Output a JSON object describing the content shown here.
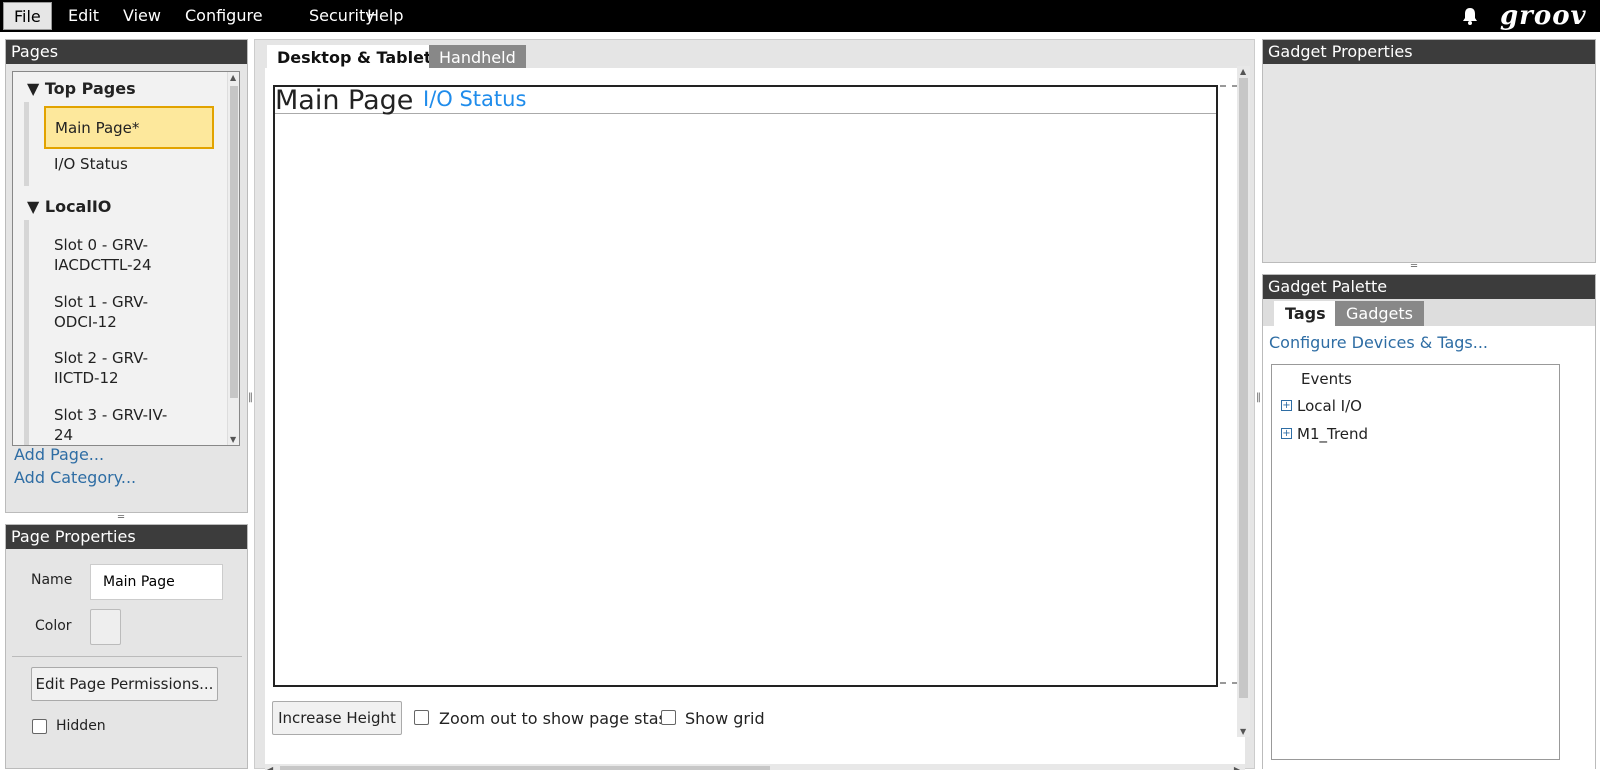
{
  "menu": [
    "File",
    "Edit",
    "View",
    "Configure",
    "Security",
    "Help"
  ],
  "brand": {
    "logo_text": "groov",
    "icon": "bell-icon"
  },
  "pages_panel": {
    "title": "Pages",
    "categories": [
      {
        "label": "▼ Top Pages",
        "items": [
          "Main Page*",
          "I/O Status"
        ],
        "selected": "Main Page*"
      },
      {
        "label": "▼ LocalIO",
        "items": [
          [
            "Slot 0 - GRV-",
            "IACDCTTL-24"
          ],
          [
            "Slot 1 - GRV-",
            "ODCI-12"
          ],
          [
            "Slot 2 - GRV-",
            "IICTD-12"
          ],
          [
            "Slot 3 - GRV-IV-",
            "24"
          ]
        ]
      }
    ],
    "add_page": "Add Page...",
    "add_category": "Add Category..."
  },
  "page_properties": {
    "title": "Page Properties",
    "name_label": "Name",
    "name_value": "Main Page",
    "color_label": "Color",
    "permissions_button": "Edit Page Permissions...",
    "hidden_label": "Hidden"
  },
  "editor": {
    "tabs": [
      "Desktop & Tablet",
      "Handheld"
    ],
    "active_tab": "Desktop & Tablet",
    "page_title": "Main Page",
    "page_link": "I/O Status",
    "increase_height": "Increase Height",
    "zoom_label": "Zoom out to show page stash",
    "grid_label": "Show grid"
  },
  "gadget_properties": {
    "title": "Gadget Properties"
  },
  "gadget_palette": {
    "title": "Gadget Palette",
    "tabs": [
      "Tags",
      "Gadgets"
    ],
    "active_tab": "Tags",
    "configure_link": "Configure Devices & Tags...",
    "tree": [
      {
        "label": "Events",
        "expandable": false
      },
      {
        "label": "Local I/O",
        "expandable": true
      },
      {
        "label": "M1_Trend",
        "expandable": true
      }
    ]
  },
  "colors": {
    "selected_bg": "#fde89c",
    "selected_border": "#e2a300",
    "link": "#2e6da4",
    "page_link": "#1f8ceb",
    "header_bg": "#3c3c3c"
  }
}
